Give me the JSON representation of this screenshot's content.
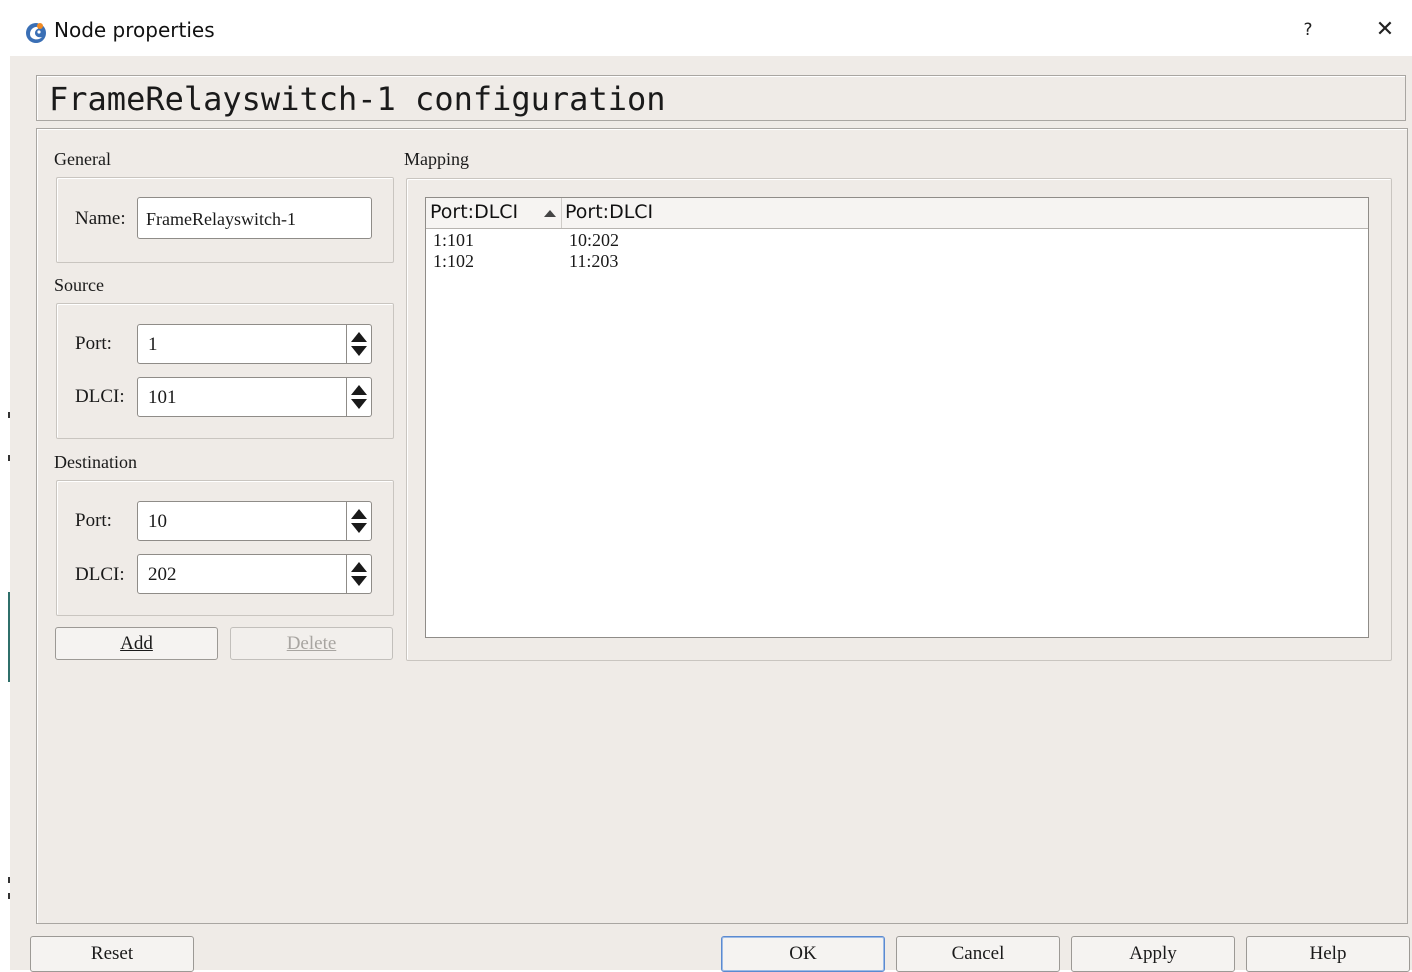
{
  "window": {
    "title": "Node properties",
    "help_glyph": "?",
    "close_glyph": "✕"
  },
  "config_title": "FrameRelayswitch-1 configuration",
  "general": {
    "title": "General",
    "name_label": "Name:",
    "name_value": "FrameRelayswitch-1"
  },
  "source": {
    "title": "Source",
    "port_label": "Port:",
    "port_value": "1",
    "dlci_label": "DLCI:",
    "dlci_value": "101"
  },
  "destination": {
    "title": "Destination",
    "port_label": "Port:",
    "port_value": "10",
    "dlci_label": "DLCI:",
    "dlci_value": "202"
  },
  "actions": {
    "add_label": "Add",
    "delete_label": "Delete"
  },
  "mapping": {
    "title": "Mapping",
    "columns": [
      "Port:DLCI",
      "Port:DLCI"
    ],
    "sort_column": 0,
    "sort_order": "ascending",
    "rows": [
      [
        "1:101",
        "10:202"
      ],
      [
        "1:102",
        "11:203"
      ]
    ]
  },
  "buttons": {
    "reset": "Reset",
    "ok": "OK",
    "cancel": "Cancel",
    "apply": "Apply",
    "help": "Help"
  },
  "colors": {
    "dialog_background": "#efebe7",
    "accent": "#5b8ad0"
  }
}
